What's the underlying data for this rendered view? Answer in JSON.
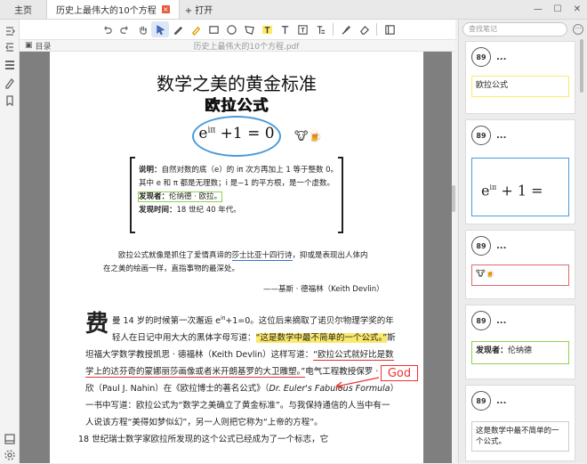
{
  "tabs": {
    "home": "主页",
    "active": "历史上最伟大的10个方程",
    "add": "+ 打开"
  },
  "window": {
    "minimize": "—",
    "maximize": "☐",
    "close": "✕"
  },
  "directory": {
    "label": "目录",
    "file": "历史上最伟大的10个方程.pdf"
  },
  "toolbar": {
    "tools": [
      "undo-icon",
      "redo-icon",
      "hand-icon",
      "cursor-icon",
      "pen-icon",
      "highlighter-icon",
      "rectangle-icon",
      "circle-icon",
      "polygon-icon",
      "text-highlight-icon",
      "text-icon",
      "textbox-icon",
      "strikethrough-icon",
      "pencil-icon",
      "eraser-icon",
      "sidebar-icon"
    ],
    "selected": "cursor-icon"
  },
  "page": {
    "title1": "数学之美的黄金标准",
    "title2": "欧拉公式",
    "formula_base": "e",
    "formula_exp": "iπ",
    "formula_rest": " +1 = 0",
    "emoji": "🐮🍺",
    "definition": {
      "label1": "说明：",
      "text1": "自然对数的底（e）的 iπ 次方再加上 1 等于整数 0。",
      "text1b": "其中 e 和 π 都是无理数；i 是−1 的平方根，是一个虚数。",
      "label2": "发现者：",
      "text2": "伦纳德 · 欧拉。",
      "label3": "发现时间：",
      "text3": "18 世纪 40 年代。"
    },
    "quote_a": "欧拉公式就像是抓住了爱情真谛的",
    "quote_ul": "莎士比亚十四行诗",
    "quote_b": "，抑或是表现出人体内在之美的绘画一样，直指事物的最深处。",
    "quote_src": "——基斯 · 德福林（Keith Devlin）",
    "body_dropcap": "费",
    "body_p1a": "曼 14 岁的时候第一次邂逅 e",
    "body_p1sup": "iπ",
    "body_p1b": "+1=0。这位后来摘取了诺贝尔物理学奖的年轻人在日记中用大大的黑体字母写道：",
    "body_hl": "“这是数学中最不简单的一个公式。”",
    "body_p2a": "斯坦福大学数学教授凯思 · 德福林（Keith Devlin）这样写道：",
    "body_ul": "“欧拉公式就好比是数学上的达芬奇的蒙娜丽莎画像或者米开朗基罗的大卫雕塑。”",
    "body_p2b": "电气工程教授保罗 · 纳欣（Paul J. Nahin）在《欧拉博士的著名公式》（",
    "body_italic": "Dr. Euler's Fabulous Formula",
    "body_p2c": "）一书中写道：欧拉公式为“数学之美确立了黄金标准”。与我保持通信的人当中有一人说该方程“美得如梦似幻”，另一人则把它称为“上帝的方程”。",
    "body_p3": "18 世纪瑞士数学家欧拉所发现的这个公式已经成为了一个标志，它",
    "god": "God"
  },
  "notes": {
    "search_placeholder": "查找笔记",
    "more": "···",
    "cards": [
      {
        "page": "89",
        "dots": "...",
        "text": "欧拉公式",
        "style": "yellow"
      },
      {
        "page": "89",
        "dots": "...",
        "formula_base": "e",
        "formula_exp": "iπ",
        "formula_rest": " + 1 =",
        "style": "blue"
      },
      {
        "page": "89",
        "dots": "...",
        "text": "🐮🍺",
        "style": "red"
      },
      {
        "page": "89",
        "dots": "...",
        "label": "发现者：",
        "text": "伦纳德",
        "style": "green"
      },
      {
        "page": "89",
        "dots": "...",
        "text": "这是数学中最不简单的一个公式。",
        "style": "gray"
      }
    ]
  },
  "colors": {
    "highlight_yellow": "#fbe96b",
    "annotation_red": "#e33333",
    "annotation_blue": "#4b9ad6",
    "annotation_green": "#8fd14f"
  }
}
